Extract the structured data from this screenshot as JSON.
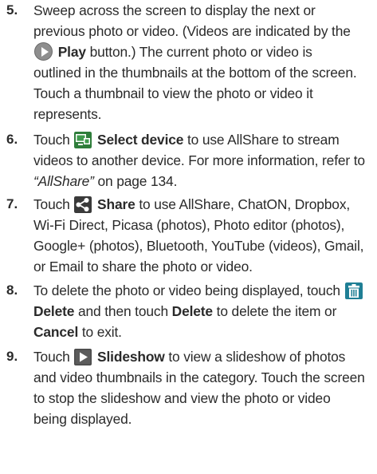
{
  "steps": [
    {
      "number": "5.",
      "lines": [
        "Sweep across the screen to display the next or",
        "previous photo or video. (Videos are indicated by the",
        "button.) The current photo or video is",
        "outlined in the thumbnails at the bottom of the screen.",
        "Touch a thumbnail to view the photo or video it",
        "represents."
      ],
      "bold": "Play"
    },
    {
      "number": "6.",
      "intro": "Touch",
      "bold": "Select device",
      "rest_line1": "to use AllShare to stream",
      "line2": "videos to another device. For more information, refer to",
      "italic_ref": "“AllShare”",
      "ref_tail": "on page 134."
    },
    {
      "number": "7.",
      "intro": "Touch",
      "bold": "Share",
      "rest_line1": "to use AllShare, ChatON, Dropbox,",
      "lines": [
        "Wi-Fi Direct, Picasa (photos), Photo editor (photos),",
        "Google+ (photos), Bluetooth, YouTube (videos), Gmail,",
        "or Email to share the photo or video."
      ]
    },
    {
      "number": "8.",
      "line1": "To delete the photo or video being displayed, touch",
      "bold_delete": "Delete",
      "mid": "and then touch",
      "bold_delete2": "Delete",
      "tail": "to delete the item or",
      "bold_cancel": "Cancel",
      "end": "to exit."
    },
    {
      "number": "9.",
      "intro": "Touch",
      "bold": "Slideshow",
      "rest_line1": "to view a slideshow of photos",
      "lines": [
        "and video thumbnails in the category. Touch the screen",
        "to stop the slideshow and view the photo or video",
        "being displayed."
      ]
    }
  ],
  "icons": {
    "play": "play-icon",
    "select_device": "select-device-icon",
    "share": "share-icon",
    "delete": "trash-icon",
    "slideshow": "slideshow-icon"
  },
  "colors": {
    "text": "#2a2a2a",
    "play_icon": "#8e8e8e",
    "select_device_icon": "#2e7d3a",
    "share_icon": "#3a3a3a",
    "delete_icon": "#1f7f95",
    "slideshow_icon": "#4a4a4a"
  }
}
